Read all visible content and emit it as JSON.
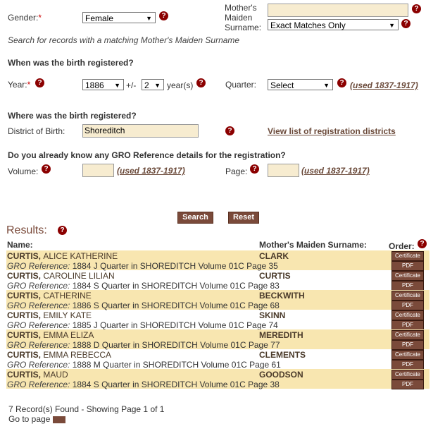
{
  "form": {
    "gender_label": "Gender:",
    "required_mark": "*",
    "gender_value": "Female",
    "mmn_label_line1": "Mother's",
    "mmn_label_line2": "Maiden",
    "mmn_label_line3": "Surname:",
    "mmn_value": "",
    "mmn_match_value": "Exact Matches Only",
    "mmn_hint": "Search for records with a matching Mother's Maiden Surname",
    "when_heading": "When was the birth registered?",
    "year_label": "Year:",
    "year_value": "1886",
    "plusminus": "+/-",
    "range_value": "2",
    "years_label": "year(s)",
    "quarter_label": "Quarter:",
    "quarter_value": "Select",
    "quarter_used": "(used 1837-1917)",
    "where_heading": "Where was the birth registered?",
    "district_label": "District of Birth:",
    "district_value": "Shoreditch",
    "district_link": "View list of registration districts",
    "gro_heading": "Do you already know any GRO Reference details for the registration?",
    "volume_label": "Volume:",
    "volume_value": "",
    "volume_used": "(used 1837-1917)",
    "page_label": "Page:",
    "page_value": "",
    "page_used": "(used 1837-1917)",
    "search_button": "Search",
    "reset_button": "Reset",
    "help_glyph": "?"
  },
  "results": {
    "title": "Results:",
    "col_name": "Name:",
    "col_mmn": "Mother's Maiden Surname:",
    "col_order": "Order:",
    "ref_prefix": "GRO Reference:",
    "certificate_label": "Certificate",
    "pdf_label": "PDF",
    "rows": [
      {
        "surname": "CURTIS,",
        "forename": "ALICE  KATHERINE",
        "ref": "1884  J Quarter in SHOREDITCH  Volume 01C  Page 35",
        "mmn": "CLARK"
      },
      {
        "surname": "CURTIS,",
        "forename": "CAROLINE  LILIAN",
        "ref": "1884  S Quarter in SHOREDITCH  Volume 01C  Page 83",
        "mmn": "CURTIS"
      },
      {
        "surname": "CURTIS,",
        "forename": "CATHERINE",
        "ref": "1886  S Quarter in SHOREDITCH  Volume 01C  Page 68",
        "mmn": "BECKWITH"
      },
      {
        "surname": "CURTIS,",
        "forename": "EMILY  KATE",
        "ref": "1885  J Quarter in SHOREDITCH  Volume 01C  Page 74",
        "mmn": "SKINN"
      },
      {
        "surname": "CURTIS,",
        "forename": "EMMA  ELIZA",
        "ref": "1888  D Quarter in SHOREDITCH  Volume 01C  Page 77",
        "mmn": "MEREDITH"
      },
      {
        "surname": "CURTIS,",
        "forename": "EMMA  REBECCA",
        "ref": "1888  M Quarter in SHOREDITCH  Volume 01C  Page 61",
        "mmn": "CLEMENTS"
      },
      {
        "surname": "CURTIS,",
        "forename": "MAUD",
        "ref": "1884  S Quarter in SHOREDITCH  Volume 01C  Page 38",
        "mmn": "GOODSON"
      }
    ],
    "records_found": "7 Record(s) Found - Showing Page 1 of 1",
    "goto_label": "Go to page"
  }
}
